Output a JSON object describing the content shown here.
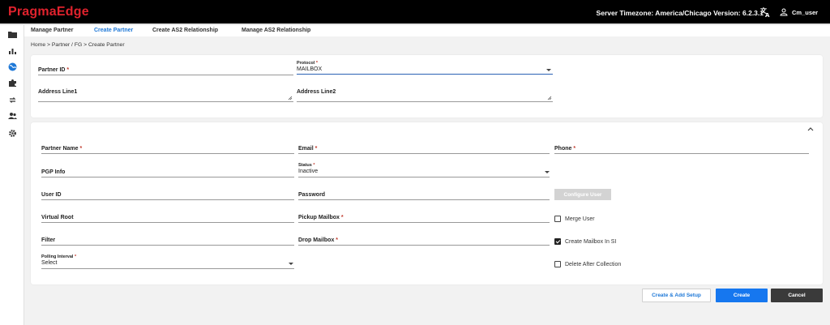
{
  "header": {
    "logo_text": "PragmaEdge",
    "server_info": "Server Timezone: America/Chicago   Version: 6.2.3.1",
    "user_name": "Cm_user",
    "translate_icon": "translate-icon",
    "user_icon": "user-icon"
  },
  "sidebar": {
    "items": [
      {
        "icon": "folder-icon"
      },
      {
        "icon": "bar-chart-icon"
      },
      {
        "icon": "globe-icon"
      },
      {
        "icon": "puzzle-icon"
      },
      {
        "icon": "sync-icon"
      },
      {
        "icon": "users-icon"
      },
      {
        "icon": "gear-icon"
      }
    ]
  },
  "subnav": {
    "items": [
      {
        "label": "Manage Partner"
      },
      {
        "label": "Create Partner"
      },
      {
        "label": "Create AS2 Relationship"
      },
      {
        "label": "Manage AS2 Relationship"
      }
    ],
    "active_index": 1
  },
  "breadcrumb": "Home  >  Partner / FG  >  Create Partner",
  "top_form": {
    "partner_id": {
      "label": "Partner ID",
      "required": "*",
      "value": ""
    },
    "protocol": {
      "label": "Protocol",
      "required": "*",
      "value": "MAILBOX"
    },
    "address1": {
      "label": "Address Line1",
      "value": ""
    },
    "address2": {
      "label": "Address Line2",
      "value": ""
    }
  },
  "details_form": {
    "partner_name": {
      "label": "Partner Name",
      "required": "*"
    },
    "email": {
      "label": "Email",
      "required": "*"
    },
    "phone": {
      "label": "Phone",
      "required": "*"
    },
    "pgp_info": {
      "label": "PGP Info"
    },
    "status": {
      "label": "Status",
      "required": "*",
      "value": "Inactive"
    },
    "user_id": {
      "label": "User ID"
    },
    "password": {
      "label": "Password"
    },
    "configure_user": "Configure User",
    "virtual_root": {
      "label": "Virtual Root"
    },
    "pickup_mailbox": {
      "label": "Pickup Mailbox",
      "required": "*"
    },
    "merge_user": {
      "label": "Merge User",
      "checked": false
    },
    "filter": {
      "label": "Filter"
    },
    "drop_mailbox": {
      "label": "Drop Mailbox",
      "required": "*"
    },
    "create_mailbox": {
      "label": "Create Mailbox In SI",
      "checked": true
    },
    "polling_interval": {
      "label": "Polling Interval",
      "required": "*",
      "value": "Select"
    },
    "delete_after": {
      "label": "Delete After Collection",
      "checked": false
    }
  },
  "actions": {
    "create_add_setup": "Create & Add Setup",
    "create": "Create",
    "cancel": "Cancel"
  },
  "colors": {
    "brand_red": "#e0222d",
    "primary_blue": "#1677ef",
    "link_blue": "#1e78d7",
    "cancel_dark": "#3a3a3a"
  }
}
